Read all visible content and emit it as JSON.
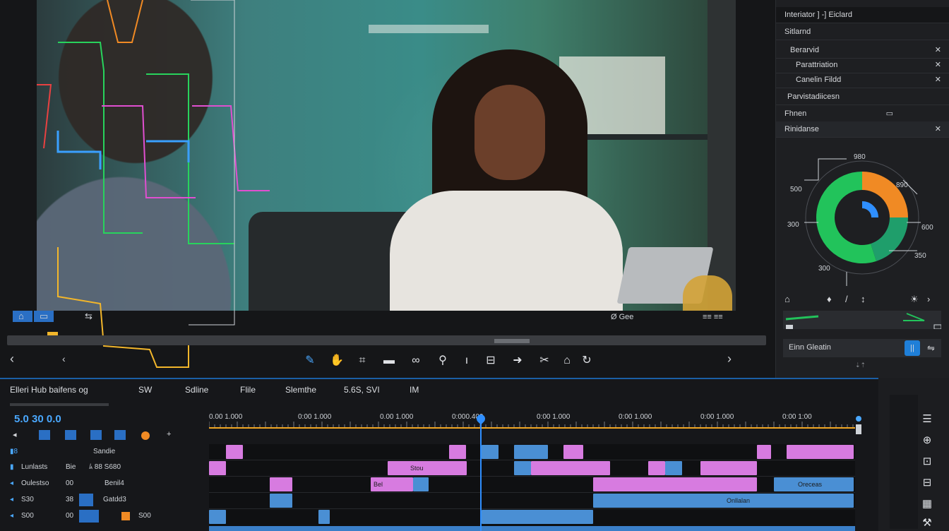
{
  "viewer": {
    "controls": {
      "mode_a": "⌂",
      "mode_b": "▭",
      "mode_c": "⇆",
      "right_text": "Ø Gee",
      "right_text2": "≡≡ ≡≡"
    },
    "toolbar_icons": [
      "pen",
      "hand",
      "crop",
      "comment",
      "link",
      "tag",
      "cursor",
      "caption",
      "arrow",
      "scissor",
      "home",
      "refresh"
    ]
  },
  "inspector": {
    "rows": [
      {
        "label": "Interiator  ] -]  Eiclard",
        "close": ""
      },
      {
        "label": "Sitlarnd",
        "close": ""
      },
      {
        "label": "Berarvid",
        "close": "✕"
      },
      {
        "label": "Parattriation",
        "close": "✕"
      },
      {
        "label": "Canelin  Fildd",
        "close": "✕"
      },
      {
        "label": "Parvistadiicesn",
        "close": ""
      },
      {
        "label": "Fhnen",
        "close": "▭"
      },
      {
        "label": "Rinidanse",
        "close": "✕"
      }
    ],
    "chart_data": {
      "type": "pie",
      "labels": [
        "980",
        "500",
        "890",
        "300",
        "600",
        "300",
        "350"
      ],
      "segments": [
        {
          "value": 25,
          "color": "#f08a24"
        },
        {
          "value": 20,
          "color": "#1f9e6b"
        },
        {
          "value": 55,
          "color": "#22c35b"
        }
      ]
    },
    "bottom_label": "Einn Gleatin",
    "bottom_btn": "||",
    "footer": "⇣⇡"
  },
  "timeline": {
    "menu": [
      "Elleri Hub baifens og",
      "SW",
      "Sdline",
      "Flile",
      "Slemthe",
      "5.6S, SVI",
      "IM"
    ],
    "timecode": "5.0  30  0.0",
    "ruler_labels": [
      "0.00  1.000",
      "0:00 1.000",
      "0.00 1.000",
      "0:000.400",
      "0:00 1.000",
      "0:00 1.000",
      "0:00 1.000",
      "0:00 1:00"
    ],
    "tracks": [
      {
        "icon": "▮8",
        "name": "",
        "c1": "",
        "c2": "Sandie"
      },
      {
        "icon": "▮",
        "name": "Lunlasts",
        "c1": "Bie",
        "c2": "ﾑ  88 S680"
      },
      {
        "icon": "◂",
        "name": "Oulestso",
        "c1": "00",
        "c2": "Benil4"
      },
      {
        "icon": "◂",
        "name": "S30",
        "c1": "38",
        "c2": "Gatdd3"
      },
      {
        "icon": "◂",
        "name": "S00",
        "c1": "00",
        "c2": "S00"
      }
    ],
    "clip_labels": {
      "a": "Stou",
      "b": "Bel",
      "c": "Oreceas",
      "d": "Onllalan"
    }
  },
  "colors": {
    "accent": "#1f7fd8",
    "pink": "#d77be0",
    "blue": "#4a8fd4",
    "orange": "#f08a24",
    "green": "#22c35b"
  }
}
